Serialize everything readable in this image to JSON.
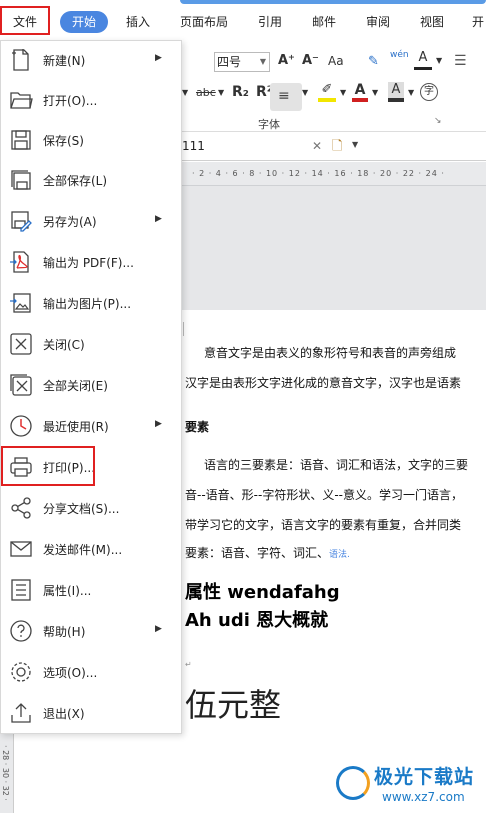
{
  "tabs": [
    {
      "label": "文件"
    },
    {
      "label": "开始"
    },
    {
      "label": "插入"
    },
    {
      "label": "页面布局"
    },
    {
      "label": "引用"
    },
    {
      "label": "邮件"
    },
    {
      "label": "审阅"
    },
    {
      "label": "视图"
    },
    {
      "label": "开"
    }
  ],
  "toolbar": {
    "font_size": "四号",
    "grow_font": "A⁺",
    "shrink_font": "A⁻",
    "change_case": "Aa",
    "pinyin": "wén",
    "strikethrough": "abc",
    "subscript": "R₂",
    "superscript": "R²",
    "group_label": "字体",
    "font_color_letter": "A",
    "enclose_char": "字"
  },
  "document": {
    "tab_name": "111",
    "ruler": "· 2 · 4 · 6 · 8 · 10 · 12 · 14 · 16 · 18 · 20 · 22 · 24 ·",
    "vruler": "· 28 · 30 · 32 ·",
    "para1": "意音文字是由表义的象形符号和表音的声旁组成",
    "para2": "汉字是由表形文字进化成的意音文字，汉字也是语素",
    "heading1": "要素",
    "para3": "语言的三要素是：语音、词汇和语法，文字的三要",
    "para4": "音--语音、形--字符形状、义--意义。学习一门语言，",
    "para5": "带学习它的文字，语言文字的要素有重复，合并同类",
    "para6_main": "要素：语音、字符、词汇、",
    "para6_small": "语法.",
    "bold1": "属性 wendafahg",
    "bold2": "Ah udi 恩大概就",
    "big": "伍元整"
  },
  "menu": {
    "items": [
      {
        "label": "新建(N)",
        "icon": "new-document-icon",
        "submenu": true
      },
      {
        "label": "打开(O)...",
        "icon": "folder-open-icon",
        "submenu": false
      },
      {
        "label": "保存(S)",
        "icon": "save-icon",
        "submenu": false
      },
      {
        "label": "全部保存(L)",
        "icon": "save-all-icon",
        "submenu": false
      },
      {
        "label": "另存为(A)",
        "icon": "save-as-icon",
        "submenu": true
      },
      {
        "label": "输出为 PDF(F)...",
        "icon": "export-pdf-icon",
        "submenu": false
      },
      {
        "label": "输出为图片(P)...",
        "icon": "export-image-icon",
        "submenu": false
      },
      {
        "label": "关闭(C)",
        "icon": "close-icon",
        "submenu": false
      },
      {
        "label": "全部关闭(E)",
        "icon": "close-all-icon",
        "submenu": false
      },
      {
        "label": "最近使用(R)",
        "icon": "recent-clock-icon",
        "submenu": true
      },
      {
        "label": "打印(P)...",
        "icon": "printer-icon",
        "submenu": false
      },
      {
        "label": "分享文档(S)...",
        "icon": "share-icon",
        "submenu": false
      },
      {
        "label": "发送邮件(M)...",
        "icon": "mail-icon",
        "submenu": false
      },
      {
        "label": "属性(I)...",
        "icon": "properties-icon",
        "submenu": false
      },
      {
        "label": "帮助(H)",
        "icon": "help-icon",
        "submenu": true
      },
      {
        "label": "选项(O)...",
        "icon": "options-gear-icon",
        "submenu": false
      },
      {
        "label": "退出(X)",
        "icon": "exit-icon",
        "submenu": false
      }
    ]
  },
  "watermark": {
    "title": "极光下载站",
    "url": "www.xz7.com"
  },
  "colors": {
    "accent": "#4a86e0",
    "highlight_box": "#e02020"
  }
}
